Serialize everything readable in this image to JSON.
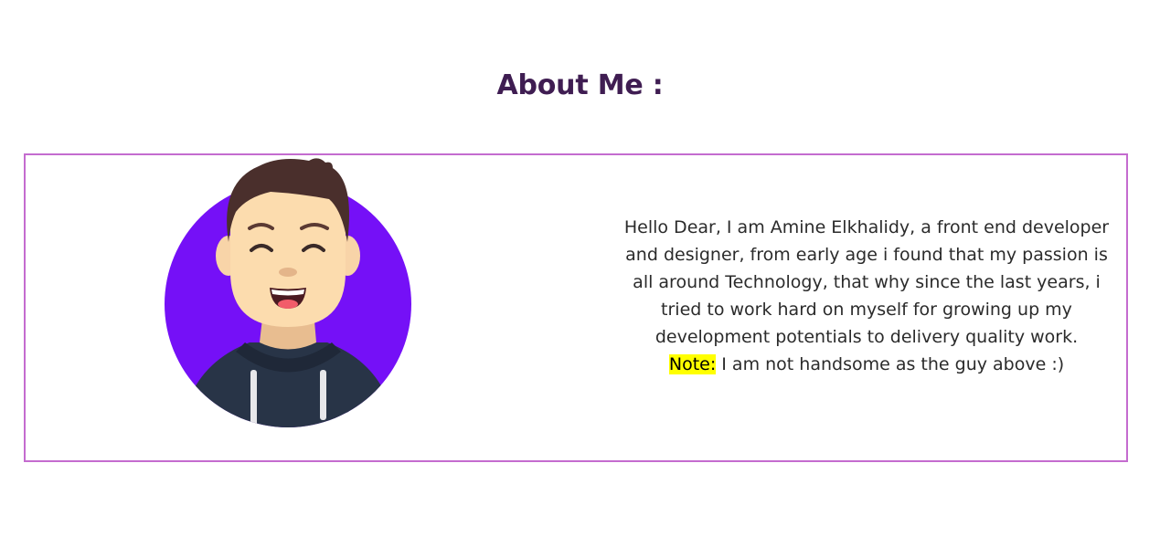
{
  "colors": {
    "title": "#3f1d52",
    "card_border": "#c46ccf",
    "avatar_background": "#7510f7",
    "note_highlight": "#ffff00",
    "text": "#2b2b2b"
  },
  "section": {
    "title": "About Me :"
  },
  "about": {
    "avatar_icon": "smiling-man-avatar-icon",
    "bio_text": "Hello Dear, I am Amine Elkhalidy, a front end developer and designer, from early age i found that my passion is all around Technology, that why since the last years, i tried to work hard on myself for growing up my development potentials to delivery quality work.",
    "note_label": "Note:",
    "note_text": " I am not handsome as the guy above :)"
  }
}
